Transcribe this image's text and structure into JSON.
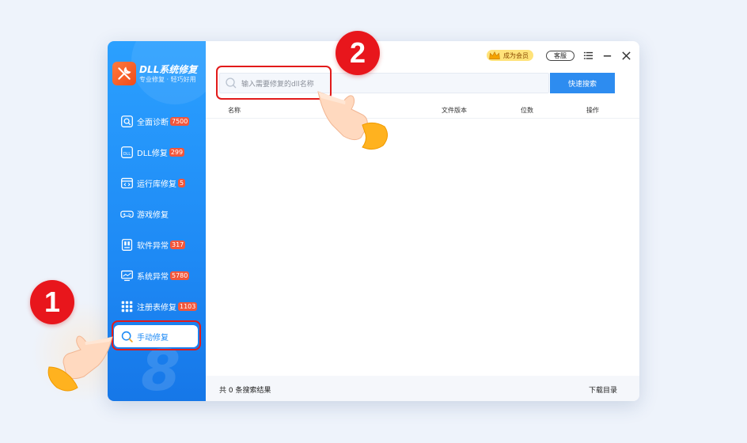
{
  "app": {
    "title": "DLL系统修复",
    "subtitle": "专业修复 · 轻巧好用",
    "watermark": "8"
  },
  "sidebar": {
    "items": [
      {
        "label": "全面诊断",
        "badge": "7500",
        "icon": "scan-icon"
      },
      {
        "label": "DLL修复",
        "badge": "299",
        "icon": "dll-file-icon"
      },
      {
        "label": "运行库修复",
        "badge": "5",
        "icon": "code-window-icon"
      },
      {
        "label": "游戏修复",
        "badge": "",
        "icon": "gamepad-icon"
      },
      {
        "label": "软件异常",
        "badge": "317",
        "icon": "software-icon"
      },
      {
        "label": "系统异常",
        "badge": "5780",
        "icon": "monitor-icon"
      },
      {
        "label": "注册表修复",
        "badge": "1103",
        "icon": "grid-icon"
      },
      {
        "label": "手动修复",
        "badge": "",
        "icon": "manual-search-icon",
        "active": true
      }
    ]
  },
  "topbar": {
    "vip_label": "成为会员",
    "service_label": "客服"
  },
  "search": {
    "placeholder": "输入需要修复的dll名称",
    "button_label": "快速搜索"
  },
  "table": {
    "columns": [
      "名称",
      "文件版本",
      "位数",
      "操作"
    ],
    "rows": []
  },
  "footer": {
    "result_text": "共 0 条搜索结果",
    "download_label": "下载目录"
  },
  "callouts": {
    "step1": "1",
    "step2": "2"
  },
  "colors": {
    "accent": "#2d8cf0",
    "badge": "#f2563b",
    "highlight": "#e21a1a"
  }
}
